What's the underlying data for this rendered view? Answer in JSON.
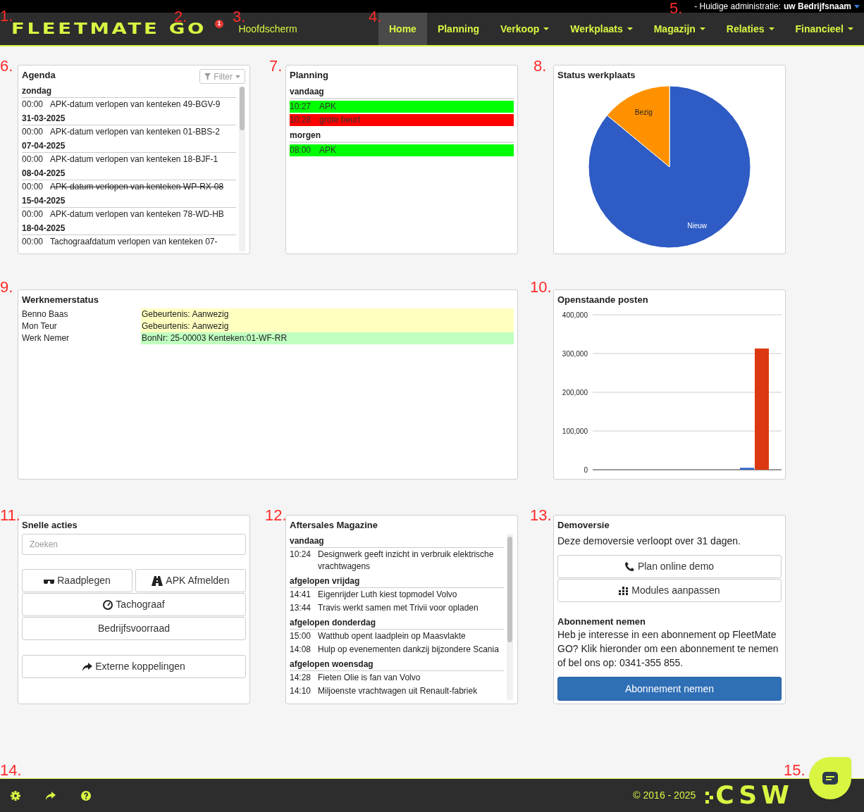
{
  "topbar": {
    "prefix": "- Huidige administratie:",
    "company": "uw Bedrijfsnaam"
  },
  "nav": {
    "logo": "FLEETMATE GO",
    "badge": "1",
    "page_title": "Hoofdscherm",
    "items": [
      {
        "label": "Home",
        "selected": true,
        "dropdown": false
      },
      {
        "label": "Planning",
        "selected": false,
        "dropdown": false
      },
      {
        "label": "Verkoop",
        "selected": false,
        "dropdown": true
      },
      {
        "label": "Werkplaats",
        "selected": false,
        "dropdown": true
      },
      {
        "label": "Magazijn",
        "selected": false,
        "dropdown": true
      },
      {
        "label": "Relaties",
        "selected": false,
        "dropdown": true
      },
      {
        "label": "Financieel",
        "selected": false,
        "dropdown": true
      }
    ]
  },
  "agenda": {
    "title": "Agenda",
    "filter": "Filter",
    "groups": [
      {
        "date": "zondag",
        "items": [
          {
            "time": "00:00",
            "text": "APK-datum verlopen van kenteken 49-BGV-9",
            "struck": false
          }
        ]
      },
      {
        "date": "31-03-2025",
        "items": [
          {
            "time": "00:00",
            "text": "APK-datum verlopen van kenteken 01-BBS-2",
            "struck": false
          }
        ]
      },
      {
        "date": "07-04-2025",
        "items": [
          {
            "time": "00:00",
            "text": "APK-datum verlopen van kenteken 18-BJF-1",
            "struck": false
          }
        ]
      },
      {
        "date": "08-04-2025",
        "items": [
          {
            "time": "00:00",
            "text": "APK-datum verlopen van kenteken WP-RX-08",
            "struck": true
          }
        ]
      },
      {
        "date": "15-04-2025",
        "items": [
          {
            "time": "00:00",
            "text": "APK-datum verlopen van kenteken 78-WD-HB",
            "struck": false
          }
        ]
      },
      {
        "date": "18-04-2025",
        "items": [
          {
            "time": "00:00",
            "text": "Tachograafdatum verlopen van kenteken 07-",
            "struck": false
          }
        ]
      }
    ]
  },
  "planning": {
    "title": "Planning",
    "groups": [
      {
        "day": "vandaag",
        "items": [
          {
            "time": "10:27",
            "text": "APK",
            "color": "#00ff00"
          },
          {
            "time": "10:28",
            "text": "grote beurt",
            "color": "#ff0000"
          }
        ]
      },
      {
        "day": "morgen",
        "items": [
          {
            "time": "08:00",
            "text": "APK",
            "color": "#00ff00"
          }
        ]
      }
    ]
  },
  "status_werkplaats": {
    "title": "Status werkplaats",
    "chart_data": {
      "type": "pie",
      "categories": [
        "Nieuw",
        "Bezig"
      ],
      "values": [
        86,
        14
      ],
      "colors": [
        "#2e5bc4",
        "#ff9100"
      ]
    }
  },
  "werknemerstatus": {
    "title": "Werknemerstatus",
    "rows": [
      {
        "name": "Benno Baas",
        "status": "Gebeurtenis: Aanwezig",
        "color": "#ffffc0"
      },
      {
        "name": "Mon Teur",
        "status": "Gebeurtenis: Aanwezig",
        "color": "#ffffc0"
      },
      {
        "name": "Werk Nemer",
        "status": "BonNr: 25-00003 Kenteken:01-WF-RR",
        "color": "#c0ffc0"
      }
    ]
  },
  "openstaande_posten": {
    "title": "Openstaande posten",
    "chart_data": {
      "type": "bar",
      "grid": true,
      "ylim": [
        0,
        400000
      ],
      "yticks": [
        {
          "value": 0,
          "label": "0"
        },
        {
          "value": 100000,
          "label": "100,000"
        },
        {
          "value": 200000,
          "label": "200,000"
        },
        {
          "value": 300000,
          "label": "300,000"
        },
        {
          "value": 400000,
          "label": "400,000"
        }
      ],
      "series": [
        {
          "color": "#3366cc",
          "values": [
            5000
          ]
        },
        {
          "color": "#dc3912",
          "values": [
            313000
          ]
        }
      ]
    }
  },
  "snelle_acties": {
    "title": "Snelle acties",
    "search": {
      "placeholder": "Zoeken"
    },
    "rows": [
      [
        "Raadplegen",
        "APK Afmelden"
      ],
      [
        "Tachograaf"
      ],
      [
        "Bedrijfsvoorraad"
      ]
    ],
    "extra": "Externe koppelingen"
  },
  "aftersales": {
    "title": "Aftersales Magazine",
    "groups": [
      {
        "day": "vandaag",
        "items": [
          {
            "time": "10:24",
            "text": "Designwerk geeft inzicht in verbruik elektrische vrachtwagens"
          }
        ]
      },
      {
        "day": "afgelopen vrijdag",
        "items": [
          {
            "time": "14:41",
            "text": "Eigenrijder Luth kiest topmodel Volvo"
          },
          {
            "time": "13:44",
            "text": "Travis werkt samen met Trivii voor opladen"
          }
        ]
      },
      {
        "day": "afgelopen donderdag",
        "items": [
          {
            "time": "15:00",
            "text": "Watthub opent laadplein op Maasvlakte"
          },
          {
            "time": "14:08",
            "text": "Hulp op evenementen dankzij bijzondere Scania"
          }
        ]
      },
      {
        "day": "afgelopen woensdag",
        "items": [
          {
            "time": "14:28",
            "text": "Fieten Olie is fan van Volvo"
          },
          {
            "time": "14:10",
            "text": "Miljoenste vrachtwagen uit Renault-fabriek"
          }
        ]
      }
    ]
  },
  "demoversie": {
    "title": "Demoversie",
    "notice": "Deze demoversie verloopt over 31 dagen.",
    "buttons": [
      "Plan online demo",
      "Modules aanpassen"
    ],
    "subscribe_title": "Abonnement nemen",
    "subscribe_text": "Heb je interesse in een abonnement op FleetMate GO? Klik hieronder om een abonnement te nemen of bel ons op: 0341-355 855.",
    "subscribe_button": "Abonnement nemen"
  },
  "footer": {
    "copyright": "© 2016 - 2025",
    "logo": "CSW"
  },
  "annotations": [
    {
      "label": "1."
    },
    {
      "label": "2."
    },
    {
      "label": "3."
    },
    {
      "label": "4."
    },
    {
      "label": "5."
    },
    {
      "label": "6."
    },
    {
      "label": "7."
    },
    {
      "label": "8."
    },
    {
      "label": "9."
    },
    {
      "label": "10."
    },
    {
      "label": "11."
    },
    {
      "label": "12."
    },
    {
      "label": "13."
    },
    {
      "label": "14."
    },
    {
      "label": "15."
    }
  ]
}
